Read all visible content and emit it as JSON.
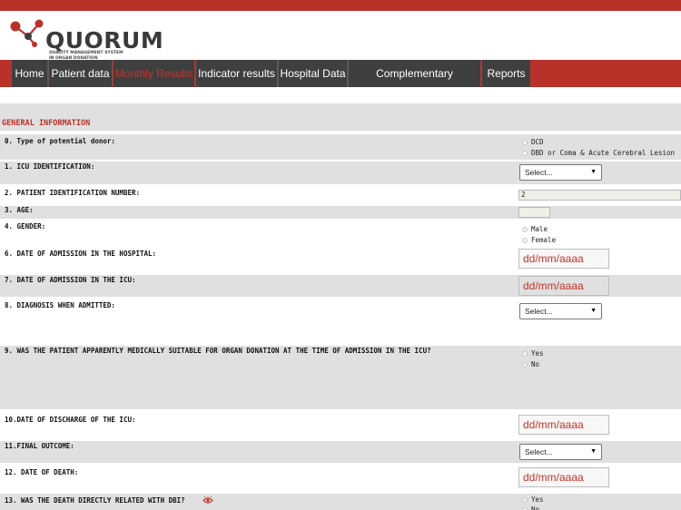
{
  "brand": {
    "name": "QUORUM",
    "subtitle_line1": "QUALITY MANAGEMENT SYSTEM",
    "subtitle_line2": "IN ORGAN DONATION",
    "accent": "#b8322a"
  },
  "nav": {
    "items": [
      {
        "label": "Home",
        "active": false
      },
      {
        "label": "Patient data",
        "active": false
      },
      {
        "label": "Monthly Results",
        "active": true
      },
      {
        "label": "Indicator results",
        "active": false
      },
      {
        "label": "Hospital Data",
        "active": false
      },
      {
        "label": "Complementary information",
        "active": false
      },
      {
        "label": "Reports",
        "active": false
      }
    ]
  },
  "section": {
    "title": "GENERAL INFORMATION"
  },
  "form": {
    "q0": {
      "label": "0. Type of potential donor:",
      "options": [
        "DCD",
        "DBD or Coma & Acute Cerebral Lesion"
      ]
    },
    "q1": {
      "label": "1. ICU IDENTIFICATION:",
      "value": "Select..."
    },
    "q2": {
      "label": "2. PATIENT IDENTIFICATION NUMBER:",
      "value": "2"
    },
    "q3": {
      "label": "3. AGE:",
      "value": ""
    },
    "q4": {
      "label": "4. GENDER:",
      "options": [
        "Male",
        "Female"
      ]
    },
    "q6": {
      "label": "6. DATE OF ADMISSION IN THE HOSPITAL:",
      "placeholder": "dd/mm/aaaa"
    },
    "q7": {
      "label": "7. DATE OF ADMISSION IN THE ICU:",
      "placeholder": "dd/mm/aaaa"
    },
    "q8": {
      "label": "8. DIAGNOSIS WHEN ADMITTED:",
      "value": "Select..."
    },
    "q9": {
      "label": "9. WAS THE PATIENT APPARENTLY MEDICALLY SUITABLE FOR ORGAN DONATION AT THE TIME OF ADMISSION IN THE ICU?",
      "options": [
        "Yes",
        "No"
      ]
    },
    "q10": {
      "label": "10.DATE OF DISCHARGE OF THE ICU:",
      "placeholder": "dd/mm/aaaa"
    },
    "q11": {
      "label": "11.FINAL OUTCOME:",
      "value": "Select..."
    },
    "q12": {
      "label": "12. DATE OF DEATH:",
      "placeholder": "dd/mm/aaaa"
    },
    "q13": {
      "label": "13. WAS THE DEATH DIRECTLY RELATED WITH DBI?",
      "options": [
        "Yes",
        "No"
      ],
      "info_icon": "eye-icon"
    }
  }
}
